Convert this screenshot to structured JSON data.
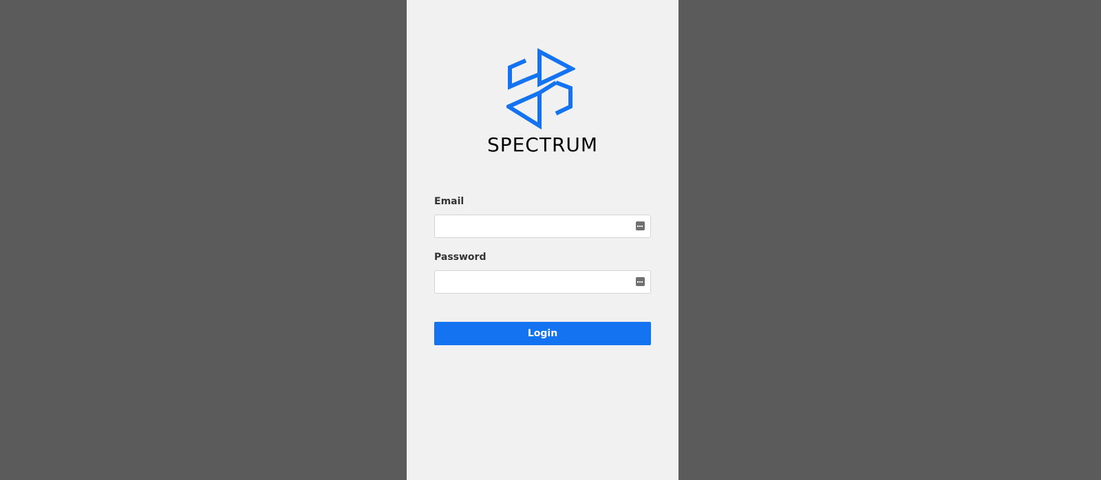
{
  "brand": {
    "name": "SPECTRUM",
    "logo_icon": "spectrum-logo-icon",
    "accent_color": "#1473f0"
  },
  "form": {
    "email_label": "Email",
    "email_value": "",
    "password_label": "Password",
    "password_value": "",
    "field_icon": "password-manager-key-icon",
    "login_label": "Login"
  },
  "colors": {
    "background": "#5b5b5b",
    "panel": "#f1f1f1",
    "button": "#1473f0",
    "button_text": "#ffffff"
  }
}
